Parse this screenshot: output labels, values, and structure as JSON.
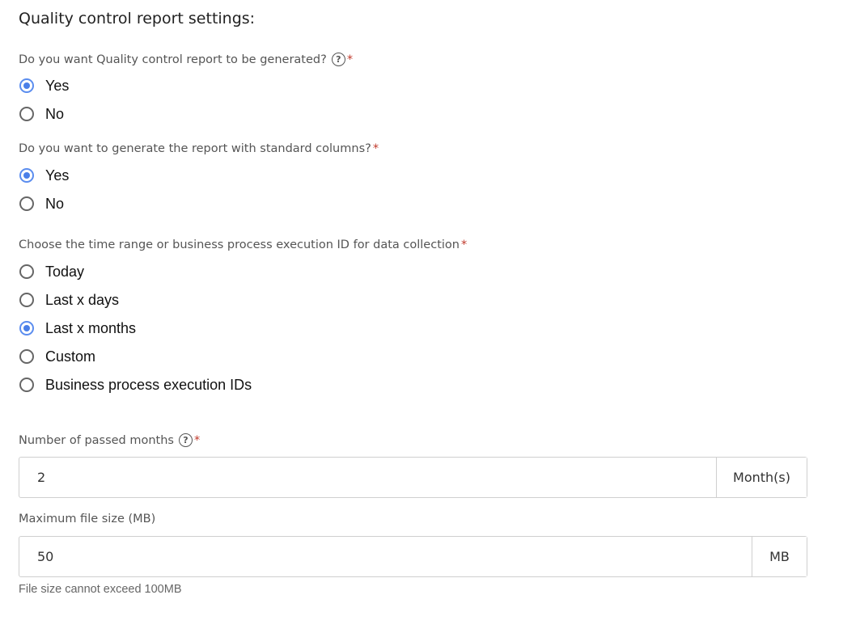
{
  "section_title": "Quality control report settings:",
  "q1": {
    "label": "Do you want Quality control report to be generated?",
    "help_icon": "question-circle-icon",
    "required_mark": "*",
    "options": [
      "Yes",
      "No"
    ],
    "selected": "Yes"
  },
  "q2": {
    "label": "Do you want to generate the report with standard columns?",
    "required_mark": "*",
    "options": [
      "Yes",
      "No"
    ],
    "selected": "Yes"
  },
  "q3": {
    "label": "Choose the time range or business process execution ID for data collection",
    "required_mark": "*",
    "options": [
      "Today",
      "Last x days",
      "Last x months",
      "Custom",
      "Business process execution IDs"
    ],
    "selected": "Last x months"
  },
  "months_field": {
    "label": "Number of passed months",
    "help_icon": "question-circle-icon",
    "required_mark": "*",
    "value": "2",
    "unit": "Month(s)"
  },
  "file_size_field": {
    "label": "Maximum file size (MB)",
    "value": "50",
    "unit": "MB",
    "hint": "File size cannot exceed 100MB"
  },
  "colors": {
    "accent": "#4a7fe8",
    "required": "#c0392b"
  }
}
